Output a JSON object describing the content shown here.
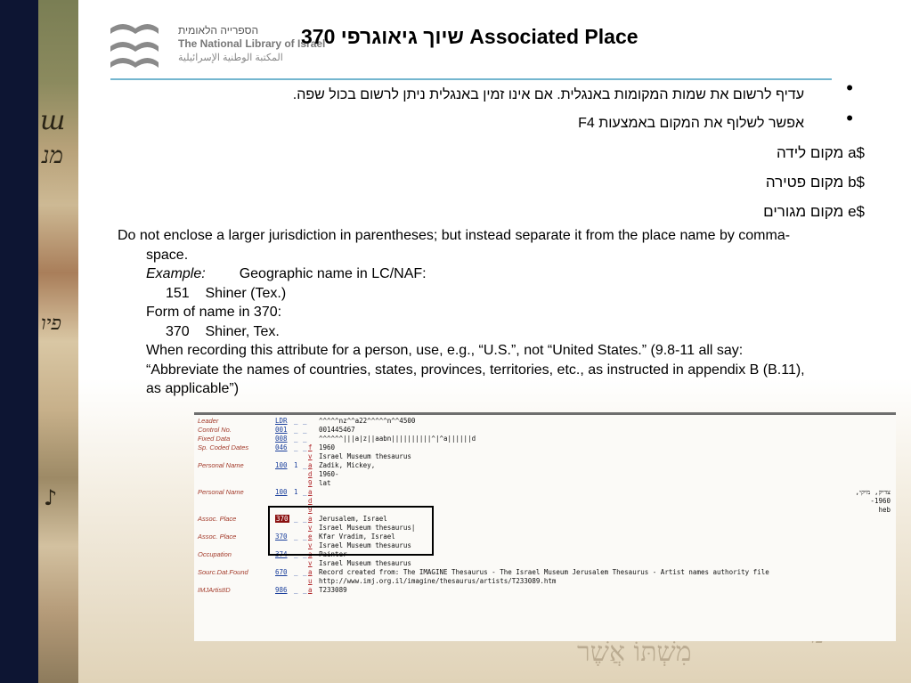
{
  "logo": {
    "hebrew": "הספרייה הלאומית",
    "english": "The National Library of Israel",
    "arabic": "المكتبة الوطنية الإسرائيلية"
  },
  "title": "370 שיוך גיאוגרפי  Associated Place",
  "bullets": [
    "עדיף לרשום את שמות המקומות באנגלית. אם אינו זמין באנגלית ניתן לרשום בכול שפה.",
    "אפשר לשלוף את המקום באמצעות F4"
  ],
  "subfields": [
    "$a מקום לידה",
    "$b מקום פטירה",
    "$e מקום מגורים"
  ],
  "body": {
    "line1": "Do not enclose a larger jurisdiction in parentheses; but instead separate it from the place name by comma-",
    "line2": "space.",
    "example_label": "Example:",
    "example_text": "Geographic name in LC/NAF:",
    "ex1": "151    Shiner (Tex.)",
    "form_label": "Form of name in 370:",
    "ex2": "370    Shiner, Tex.",
    "when1": "When recording this attribute for a person, use, e.g., “U.S.”, not “United States.” (9.8-11 all say:",
    "when2": "“Abbreviate the names of countries, states, provinces, territories, etc., as instructed in appendix B (B.11),",
    "when3": "as applicable”)"
  },
  "catalog": {
    "rows": [
      {
        "label": "Leader",
        "tag": "LDR",
        "ind1": "_",
        "ind2": "_",
        "sub": "",
        "value": "^^^^^nz^^a22^^^^^n^^4500",
        "right": ""
      },
      {
        "label": "Control No.",
        "tag": "001",
        "ind1": "_",
        "ind2": "_",
        "sub": "",
        "value": "001445467",
        "right": ""
      },
      {
        "label": "Fixed Data",
        "tag": "008",
        "ind1": "_",
        "ind2": "_",
        "sub": "",
        "value": "^^^^^^|||a|z||aabn||||||||||^|^a||||||d",
        "right": ""
      },
      {
        "label": "Sp. Coded Dates",
        "tag": "046",
        "ind1": "_",
        "ind2": "_",
        "sub": "f",
        "value": "1960",
        "right": ""
      },
      {
        "label": "",
        "tag": "",
        "ind1": "",
        "ind2": "",
        "sub": "v",
        "value": "Israel Museum thesaurus",
        "right": ""
      },
      {
        "label": "Personal Name",
        "tag": "100",
        "ind1": "1",
        "ind2": "_",
        "sub": "a",
        "value": "Zadik, Mickey,",
        "right": ""
      },
      {
        "label": "",
        "tag": "",
        "ind1": "",
        "ind2": "",
        "sub": "d",
        "value": "1960-",
        "right": ""
      },
      {
        "label": "",
        "tag": "",
        "ind1": "",
        "ind2": "",
        "sub": "9",
        "value": "lat",
        "right": ""
      },
      {
        "label": "Personal Name",
        "tag": "100",
        "ind1": "1",
        "ind2": "_",
        "sub": "a",
        "value": "",
        "right": "צדיק, מיקי,"
      },
      {
        "label": "",
        "tag": "",
        "ind1": "",
        "ind2": "",
        "sub": "d",
        "value": "",
        "right": "1960-"
      },
      {
        "label": "",
        "tag": "",
        "ind1": "",
        "ind2": "",
        "sub": "9",
        "value": "",
        "right": "heb"
      },
      {
        "label": "Assoc. Place",
        "tag": "370",
        "ind1": "_",
        "ind2": "_",
        "sub": "a",
        "value": "Jerusalem, Israel",
        "right": "",
        "highlight": true
      },
      {
        "label": "",
        "tag": "",
        "ind1": "",
        "ind2": "",
        "sub": "v",
        "value": "Israel Museum thesaurus|",
        "right": ""
      },
      {
        "label": "Assoc. Place",
        "tag": "370",
        "ind1": "_",
        "ind2": "_",
        "sub": "e",
        "value": "Kfar Vradim, Israel",
        "right": ""
      },
      {
        "label": "",
        "tag": "",
        "ind1": "",
        "ind2": "",
        "sub": "v",
        "value": "Israel Museum thesaurus",
        "right": ""
      },
      {
        "label": "Occupation",
        "tag": "374",
        "ind1": "_",
        "ind2": "_",
        "sub": "a",
        "value": "Painter",
        "right": ""
      },
      {
        "label": "",
        "tag": "",
        "ind1": "",
        "ind2": "",
        "sub": "v",
        "value": "Israel Museum thesaurus",
        "right": ""
      },
      {
        "label": "Sourc.Dat.Found",
        "tag": "670",
        "ind1": "_",
        "ind2": "_",
        "sub": "a",
        "value": "Record created from: The IMAGINE Thesaurus - The Israel Museum Jerusalem Thesaurus - Artist names authority file",
        "right": ""
      },
      {
        "label": "",
        "tag": "",
        "ind1": "",
        "ind2": "",
        "sub": "u",
        "value": "http://www.imj.org.il/imagine/thesaurus/artists/T233089.htm",
        "right": ""
      },
      {
        "label": "IMJArtistID",
        "tag": "986",
        "ind1": "_",
        "ind2": "_",
        "sub": "a",
        "value": "T233089",
        "right": ""
      }
    ]
  }
}
